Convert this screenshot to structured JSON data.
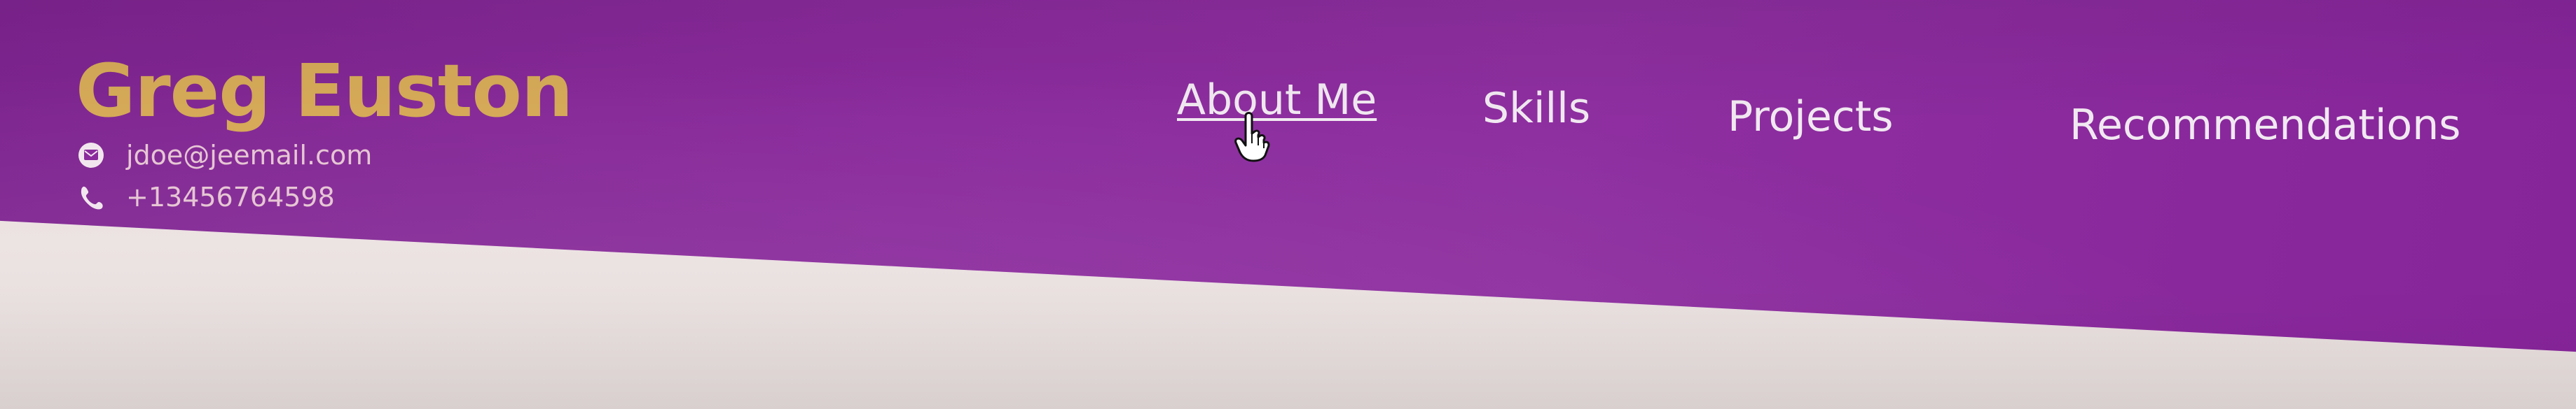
{
  "header": {
    "name": "Greg Euston",
    "email": "jdoe@jeemail.com",
    "phone": "+13456764598",
    "email_icon": "mail-icon",
    "phone_icon": "phone-icon"
  },
  "nav": {
    "items": [
      {
        "label": "About Me",
        "active": true
      },
      {
        "label": "Skills",
        "active": false
      },
      {
        "label": "Projects",
        "active": false
      },
      {
        "label": "Recommendations",
        "active": false
      }
    ],
    "hover_target": "About Me"
  },
  "colors": {
    "header_bg": "#8a2a9c",
    "name_text": "#d6aa58",
    "nav_text": "#f1e9f1",
    "page_bg": "#e9e1e1"
  },
  "icons": {
    "cursor": "hand-pointer-icon"
  }
}
